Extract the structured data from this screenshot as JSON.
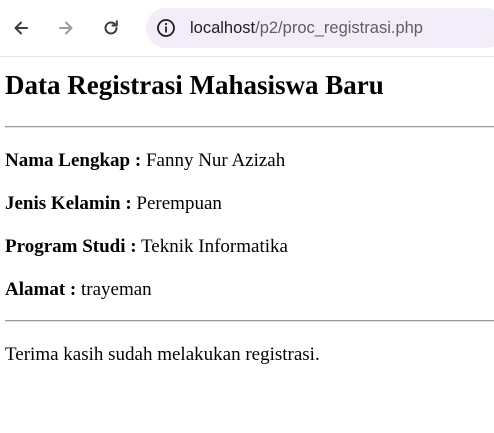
{
  "browser": {
    "url_host": "localhost",
    "url_path": "/p2/proc_registrasi.php"
  },
  "page": {
    "title": "Data Registrasi Mahasiswa Baru",
    "fields": [
      {
        "label": "Nama Lengkap :",
        "value": "Fanny Nur Azizah"
      },
      {
        "label": "Jenis Kelamin :",
        "value": "Perempuan"
      },
      {
        "label": "Program Studi :",
        "value": "Teknik Informatika"
      },
      {
        "label": "Alamat :",
        "value": "trayeman"
      }
    ],
    "thanks": "Terima kasih sudah melakukan registrasi."
  },
  "icons": {
    "back": "back-arrow-icon",
    "forward": "forward-arrow-icon",
    "reload": "reload-icon",
    "info": "info-icon"
  }
}
